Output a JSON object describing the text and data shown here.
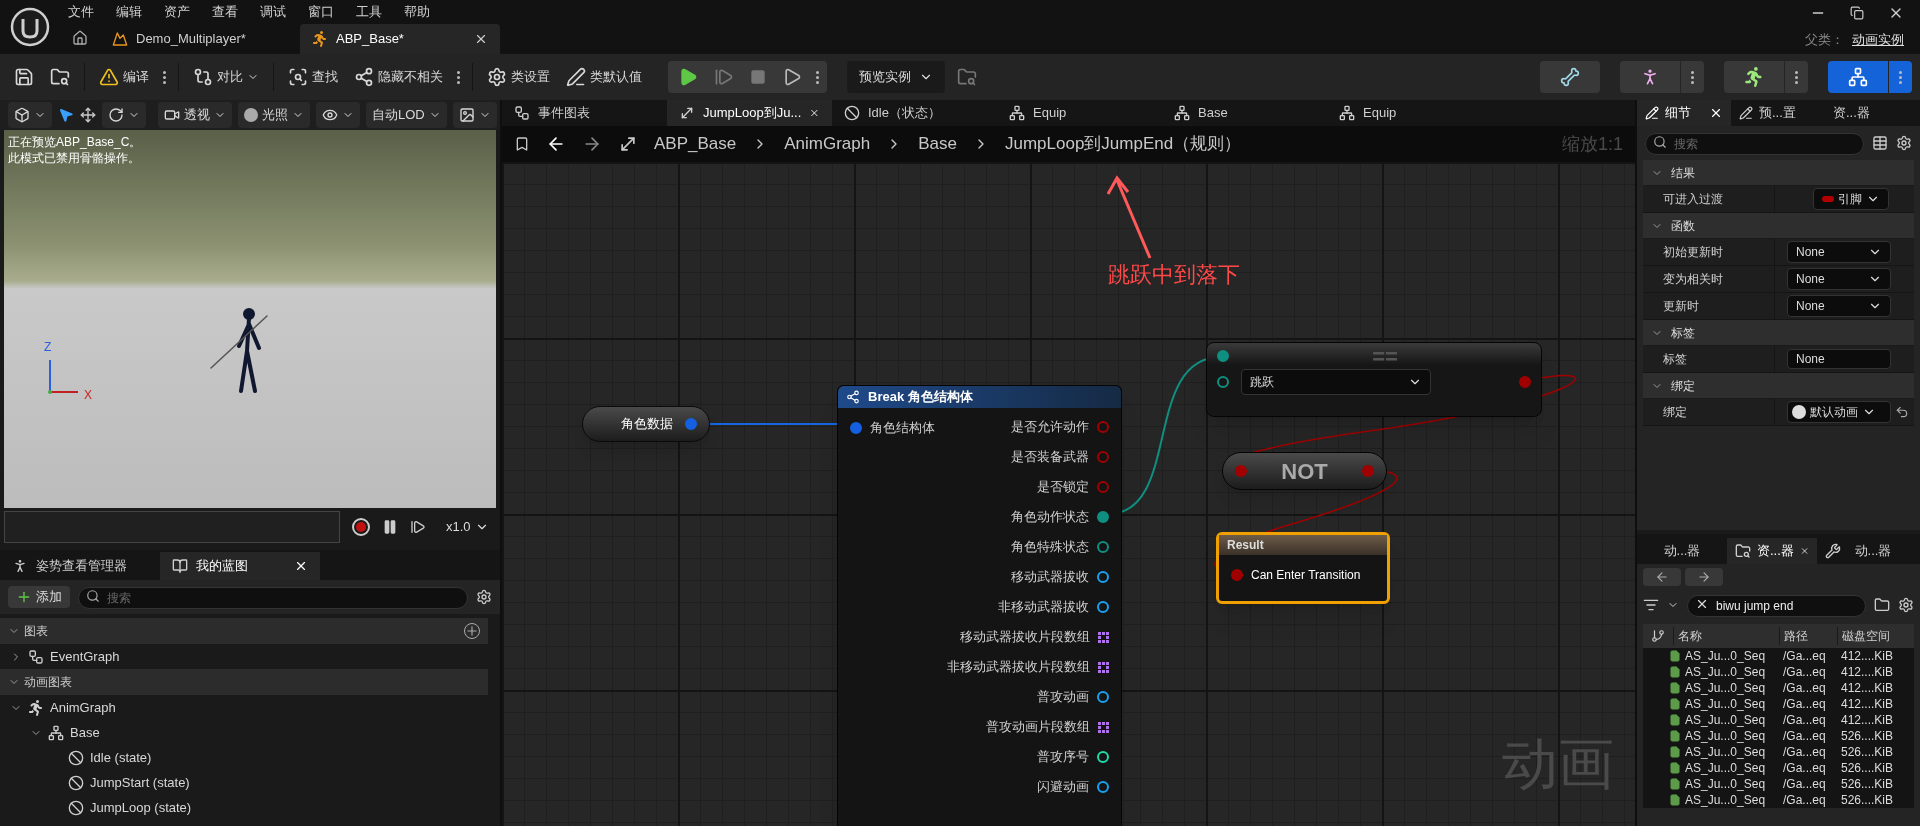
{
  "menu": [
    "文件",
    "编辑",
    "资产",
    "查看",
    "调试",
    "窗口",
    "工具",
    "帮助"
  ],
  "document_tabs": [
    {
      "label": "Demo_Multiplayer*",
      "kind": "level",
      "selected": false
    },
    {
      "label": "ABP_Base*",
      "kind": "anim_blueprint",
      "selected": true
    }
  ],
  "parent_class": {
    "label": "父类：",
    "value": "动画实例"
  },
  "toolbar": {
    "compile": "编译",
    "diff": "对比",
    "find": "查找",
    "hide_unrelated": "隐藏不相关",
    "class_settings": "类设置",
    "class_defaults": "类默认值",
    "preview_instance": "预览实例"
  },
  "modes": [
    {
      "kind": "skeleton",
      "selected": false
    },
    {
      "kind": "mesh",
      "selected": false
    },
    {
      "kind": "animation",
      "selected": false
    },
    {
      "kind": "blueprint",
      "selected": true
    }
  ],
  "viewport": {
    "menus": [
      "透视",
      "光照",
      "自动LOD"
    ],
    "messages": [
      "正在预览ABP_Base_C。",
      "此模式已禁用骨骼操作。"
    ],
    "axis": [
      "Z",
      "X"
    ],
    "speed": "x1.0"
  },
  "left_tabs": [
    {
      "label": "姿势查看管理器",
      "kind": "pose",
      "selected": false
    },
    {
      "label": "我的蓝图",
      "kind": "blueprint",
      "selected": true
    }
  ],
  "my_blueprint": {
    "add": "添加",
    "search_placeholder": "搜索",
    "sections": [
      {
        "title": "图表",
        "expanded": true,
        "items": [
          {
            "label": "EventGraph",
            "kind": "graph",
            "expanded": false
          }
        ]
      },
      {
        "title": "动画图表",
        "expanded": true,
        "items": [
          {
            "label": "AnimGraph",
            "kind": "anim",
            "expanded": true,
            "children": [
              {
                "label": "Base",
                "kind": "machine",
                "expanded": true,
                "children": [
                  {
                    "label": "Idle (state)",
                    "kind": "state"
                  },
                  {
                    "label": "JumpStart (state)",
                    "kind": "state"
                  },
                  {
                    "label": "JumpLoop (state)",
                    "kind": "state"
                  }
                ]
              }
            ]
          }
        ]
      }
    ]
  },
  "graph_tabs": [
    {
      "label": "事件图表",
      "kind": "graph",
      "selected": false
    },
    {
      "label": "JumpLoop到Ju...",
      "kind": "rule",
      "selected": true
    },
    {
      "label": "Idle（状态）",
      "kind": "state",
      "selected": false
    },
    {
      "label": "Equip",
      "kind": "machine",
      "selected": false
    },
    {
      "label": "Base",
      "kind": "machine",
      "selected": false
    },
    {
      "label": "Equip",
      "kind": "machine",
      "selected": false
    }
  ],
  "breadcrumb": [
    "ABP_Base",
    "AnimGraph",
    "Base",
    "JumpLoop到JumpEnd（规则）"
  ],
  "zoom": "缩放1:1",
  "annotation": "跳跃中到落下",
  "graph_label": "动画",
  "variable_node": {
    "label": "角色数据"
  },
  "break_node": {
    "title": "Break 角色结构体",
    "input": "角色结构体",
    "outputs": [
      {
        "label": "是否允许动作",
        "kind": "bool",
        "connected": false
      },
      {
        "label": "是否装备武器",
        "kind": "bool",
        "connected": false
      },
      {
        "label": "是否锁定",
        "kind": "bool",
        "connected": false
      },
      {
        "label": "角色动作状态",
        "kind": "enum",
        "connected": true
      },
      {
        "label": "角色特殊状态",
        "kind": "enum",
        "connected": false
      },
      {
        "label": "移动武器拔收",
        "kind": "object",
        "connected": false
      },
      {
        "label": "非移动武器拔收",
        "kind": "object",
        "connected": false
      },
      {
        "label": "移动武器拔收片段数组",
        "kind": "array",
        "connected": false
      },
      {
        "label": "非移动武器拔收片段数组",
        "kind": "array",
        "connected": false
      },
      {
        "label": "普攻动画",
        "kind": "object",
        "connected": false
      },
      {
        "label": "普攻动画片段数组",
        "kind": "array",
        "connected": false
      },
      {
        "label": "普攻序号",
        "kind": "int",
        "connected": false
      },
      {
        "label": "闪避动画",
        "kind": "object",
        "connected": false
      }
    ]
  },
  "equal_node": {
    "title": "==",
    "value": "跳跃"
  },
  "not_node": {
    "title": "NOT"
  },
  "result_node": {
    "title": "Result",
    "input": "Can Enter Transition"
  },
  "details_tabs": [
    {
      "label": "细节",
      "selected": true
    },
    {
      "label": "预...置",
      "selected": false
    },
    {
      "label": "资...器",
      "selected": false
    }
  ],
  "details": {
    "search_placeholder": "搜索",
    "sections": [
      {
        "title": "结果",
        "expanded": true,
        "rows": [
          {
            "label": "可进入过渡",
            "kind": "pin",
            "value": "引脚"
          }
        ]
      },
      {
        "title": "函数",
        "expanded": true,
        "rows": [
          {
            "label": "初始更新时",
            "kind": "select",
            "value": "None"
          },
          {
            "label": "变为相关时",
            "kind": "select",
            "value": "None"
          },
          {
            "label": "更新时",
            "kind": "select",
            "value": "None"
          }
        ]
      },
      {
        "title": "标签",
        "expanded": true,
        "rows": [
          {
            "label": "标签",
            "kind": "text",
            "value": "None"
          }
        ]
      },
      {
        "title": "绑定",
        "expanded": true,
        "rows": [
          {
            "label": "绑定",
            "kind": "binding",
            "value": "默认动画"
          }
        ]
      }
    ]
  },
  "browser_tabs": [
    {
      "label": "动...器",
      "selected": false
    },
    {
      "label": "资...器",
      "kind": "assets",
      "selected": true
    },
    {
      "label": "动...器",
      "kind": "tools",
      "selected": false
    }
  ],
  "asset_browser": {
    "filter": "biwu jump end",
    "columns": [
      "名称",
      "路径",
      "磁盘空间"
    ],
    "rows": [
      {
        "name": "AS_Ju...0_Seq",
        "path": "/Ga...eq",
        "size": "412....KiB"
      },
      {
        "name": "AS_Ju...0_Seq",
        "path": "/Ga...eq",
        "size": "412....KiB"
      },
      {
        "name": "AS_Ju...0_Seq",
        "path": "/Ga...eq",
        "size": "412....KiB"
      },
      {
        "name": "AS_Ju...0_Seq",
        "path": "/Ga...eq",
        "size": "412....KiB"
      },
      {
        "name": "AS_Ju...0_Seq",
        "path": "/Ga...eq",
        "size": "412....KiB"
      },
      {
        "name": "AS_Ju...0_Seq",
        "path": "/Ga...eq",
        "size": "526....KiB"
      },
      {
        "name": "AS_Ju...0_Seq",
        "path": "/Ga...eq",
        "size": "526....KiB"
      },
      {
        "name": "AS_Ju...0_Seq",
        "path": "/Ga...eq",
        "size": "526....KiB"
      },
      {
        "name": "AS_Ju...0_Seq",
        "path": "/Ga...eq",
        "size": "526....KiB"
      },
      {
        "name": "AS_Ju...0_Seq",
        "path": "/Ga...eq",
        "size": "526....KiB"
      }
    ]
  }
}
